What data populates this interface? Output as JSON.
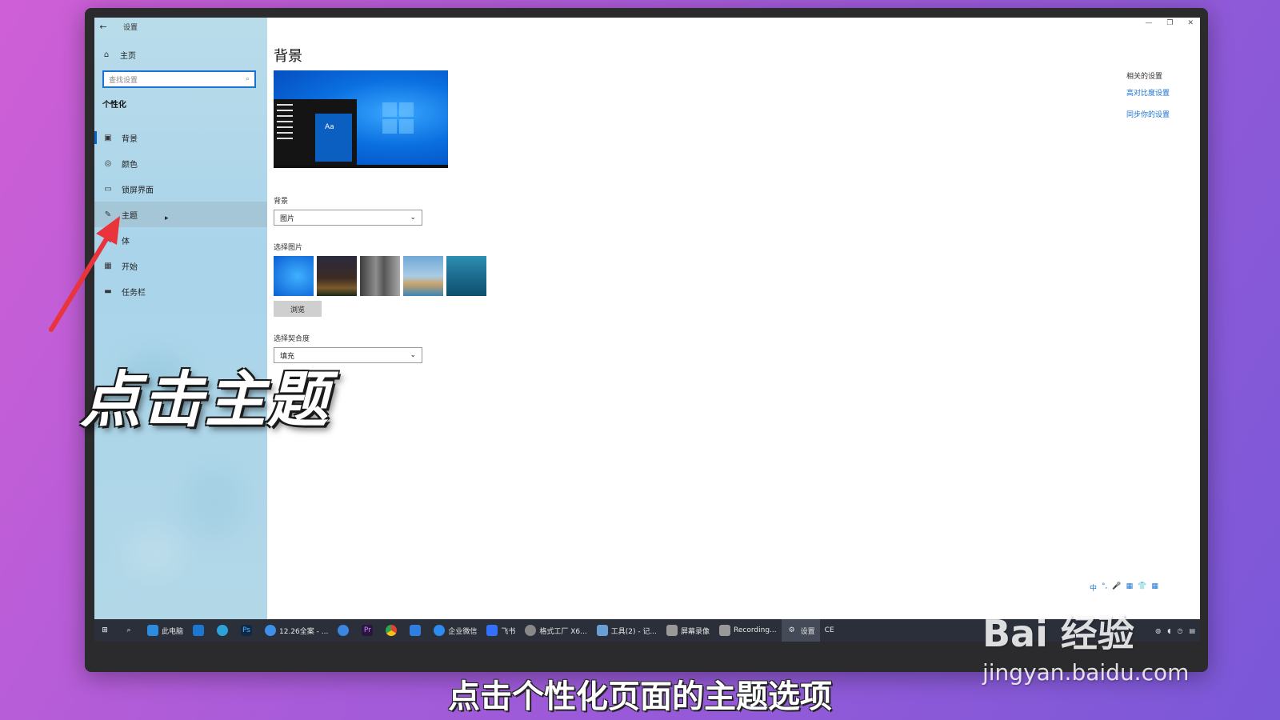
{
  "window": {
    "back_icon": "back-arrow-icon",
    "app_title": "设置",
    "controls": [
      "—",
      "❐",
      "✕"
    ]
  },
  "sidebar": {
    "home_label": "主页",
    "search_placeholder": "查找设置",
    "section_title": "个性化",
    "items": [
      {
        "label": "背景",
        "icon": "picture-icon"
      },
      {
        "label": "颜色",
        "icon": "palette-icon"
      },
      {
        "label": "锁屏界面",
        "icon": "lockscreen-icon"
      },
      {
        "label": "主题",
        "icon": "brush-icon"
      },
      {
        "label": "体",
        "icon": "font-icon"
      },
      {
        "label": "开始",
        "icon": "start-icon"
      },
      {
        "label": "任务栏",
        "icon": "taskbar-icon"
      }
    ]
  },
  "main": {
    "page_title": "背景",
    "preview_tile_text": "Aa",
    "background_label": "背景",
    "background_value": "图片",
    "choose_picture_label": "选择图片",
    "browse_label": "浏览",
    "fit_label": "选择契合度",
    "fit_value": "填充"
  },
  "related": {
    "title": "相关的设置",
    "links": [
      "高对比度设置",
      "同步你的设置"
    ]
  },
  "taskbar": {
    "items": [
      {
        "label": "",
        "icon": "windows-start-icon"
      },
      {
        "label": "",
        "icon": "search-icon"
      },
      {
        "label": "此电脑",
        "icon": "computer-icon"
      },
      {
        "label": "",
        "icon": "mail-icon"
      },
      {
        "label": "",
        "icon": "browser-icon"
      },
      {
        "label": "Ps",
        "icon": "photoshop-icon"
      },
      {
        "label": "12.26全案 - ...",
        "icon": "app-icon"
      },
      {
        "label": "",
        "icon": "app-icon"
      },
      {
        "label": "Pr",
        "icon": "premiere-icon"
      },
      {
        "label": "",
        "icon": "chrome-icon"
      },
      {
        "label": "",
        "icon": "app-icon"
      },
      {
        "label": "企业微信",
        "icon": "wecom-icon"
      },
      {
        "label": "飞书",
        "icon": "feishu-icon"
      },
      {
        "label": "格式工厂 X6...",
        "icon": "app-icon"
      },
      {
        "label": "工具(2) - 记...",
        "icon": "notepad-icon"
      },
      {
        "label": "屏幕录像",
        "icon": "recorder-icon"
      },
      {
        "label": "Recording...",
        "icon": "recorder-icon"
      },
      {
        "label": "设置",
        "icon": "gear-icon"
      }
    ],
    "tray_text": "CE"
  },
  "ime_bar": [
    "中",
    "°,",
    "🎤",
    "▦",
    "👕",
    "▦"
  ],
  "overlay": {
    "title": "点击主题",
    "subtitle": "点击个性化页面的主题选项"
  },
  "watermark": {
    "main": "Bai 经验",
    "sub": "jingyan.baidu.com"
  }
}
